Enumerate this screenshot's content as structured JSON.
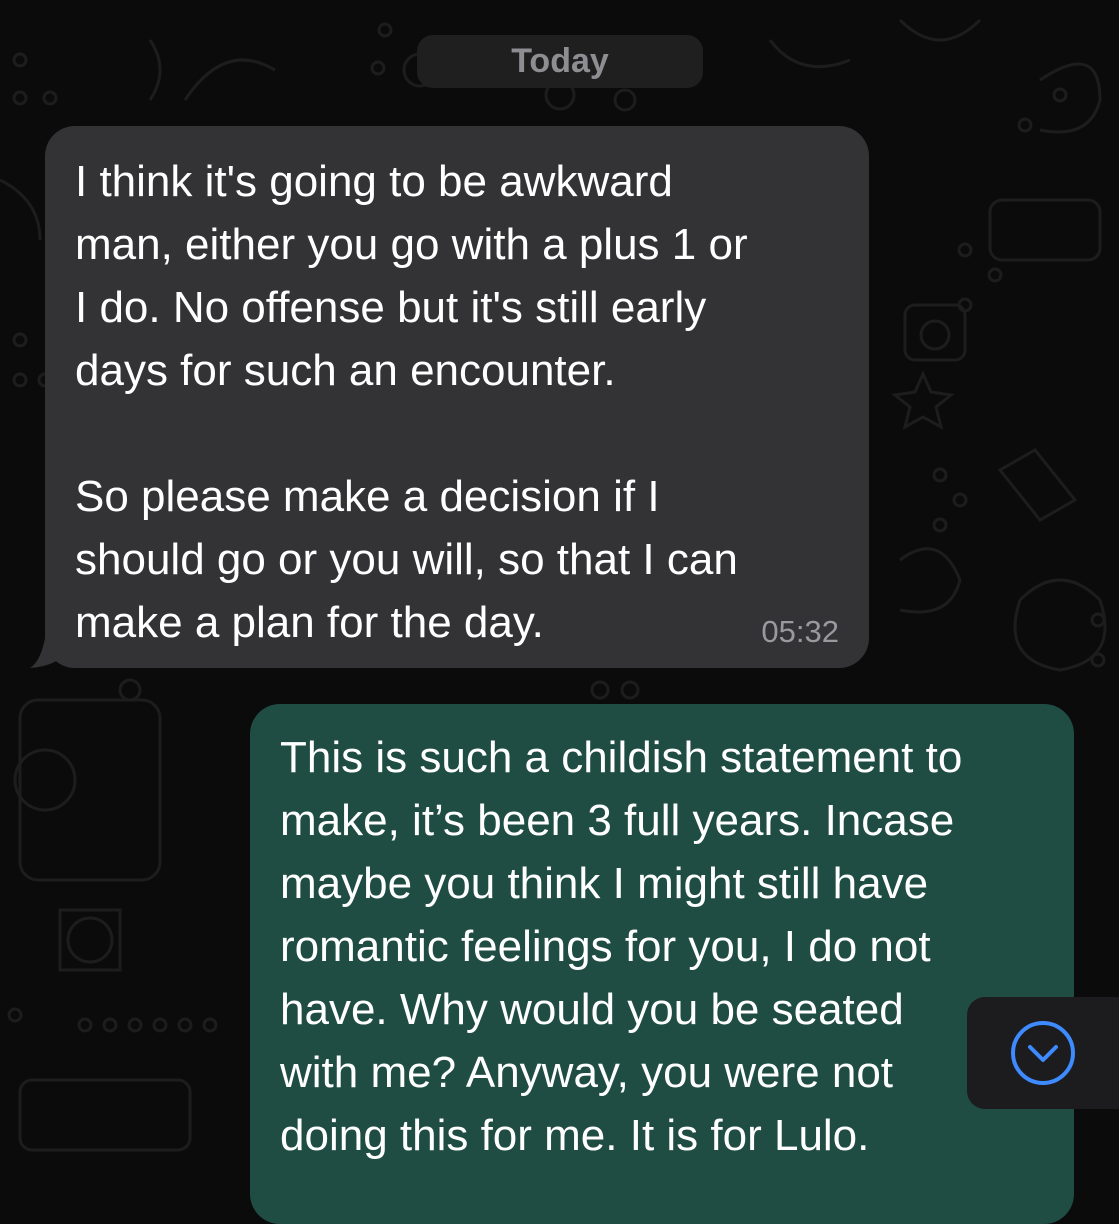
{
  "chat": {
    "date_separator": "Today",
    "messages": [
      {
        "direction": "incoming",
        "text": "I think it's going to be awkward\nman, either you go with a plus 1 or\nI do. No offense but it's still early\ndays for such an encounter.\n\nSo please make a decision if I\nshould go or you will, so that I can\nmake a plan for the day.",
        "time": "05:32"
      },
      {
        "direction": "outgoing",
        "text": "This is such a childish statement to\nmake, it’s been 3 full years. Incase\nmaybe you think I might still have\nromantic feelings for you, I do not\nhave. Why would you be seated\nwith me? Anyway, you were not\ndoing this for me. It is for Lulo."
      }
    ]
  },
  "scroll_button": {
    "icon": "chevron-down-circle-icon"
  },
  "colors": {
    "background": "#0b0b0b",
    "incoming_bubble": "#333335",
    "outgoing_bubble": "#1f4d43",
    "accent_blue": "#3d8bff",
    "timestamp": "#9a9a9e"
  }
}
